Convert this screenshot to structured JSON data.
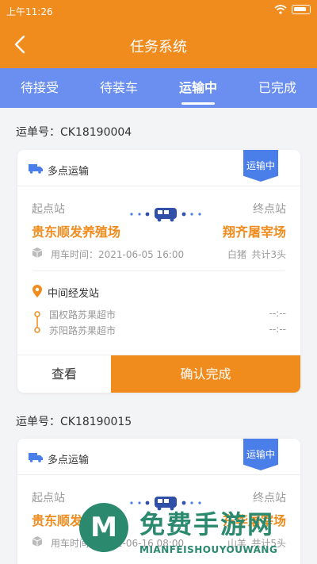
{
  "status_bar": {
    "time": "上午11:26"
  },
  "app_bar": {
    "title": "任务系统"
  },
  "tabs": [
    {
      "label": "待接受",
      "active": false
    },
    {
      "label": "待装车",
      "active": false
    },
    {
      "label": "运输中",
      "active": true
    },
    {
      "label": "已完成",
      "active": false
    }
  ],
  "orders": [
    {
      "waybill": "运单号：CK18190004",
      "type": "多点运输",
      "status_badge": "运输中",
      "origin_label": "起点站",
      "dest_label": "终点站",
      "origin": "贵东顺发养殖场",
      "destination": "翔齐屠宰场",
      "use_time": "用车时间：2021-06-05 16:00",
      "cargo": "白猪",
      "total": "共计3头",
      "mid_title": "中间经发站",
      "stops": [
        {
          "name": "国权路苏果超市",
          "time": "--:--"
        },
        {
          "name": "苏阳路苏果超市",
          "time": "--:--"
        }
      ],
      "view_label": "查看",
      "confirm_label": "确认完成"
    },
    {
      "waybill": "运单号：CK18190015",
      "type": "多点运输",
      "status_badge": "运输中",
      "origin_label": "起点站",
      "dest_label": "终点站",
      "origin": "贵东顺发养殖场",
      "destination": "东华屠宰场",
      "use_time": "用车时间：2021-06-16 08:00",
      "cargo": "山羊",
      "total": "共计5头"
    }
  ],
  "watermark": {
    "logo_letter": "M",
    "text": "免费手游网",
    "sub": "MIANFEISHOUYOUWANG"
  },
  "colors": {
    "brand_orange": "#f08c1e",
    "tab_blue": "#6a8ff0",
    "badge_blue": "#4a7ee8",
    "watermark_green": "#2b8a6e"
  }
}
